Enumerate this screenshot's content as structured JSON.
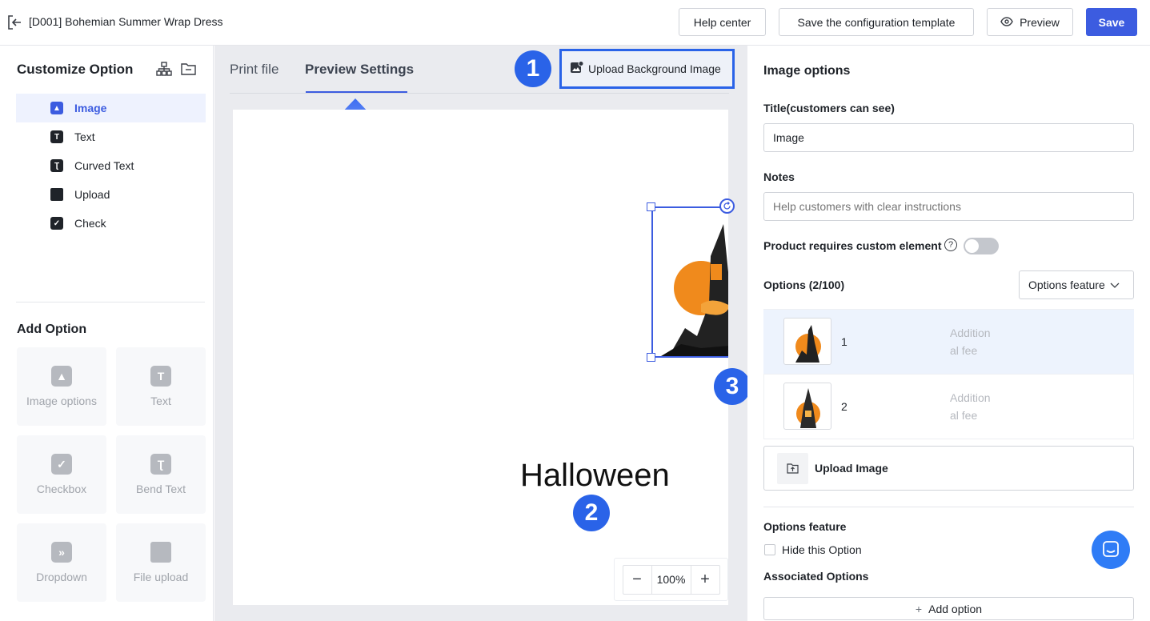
{
  "header": {
    "title": "[D001] Bohemian Summer Wrap Dress",
    "help_label": "Help center",
    "save_template_label": "Save the configuration template",
    "preview_label": "Preview",
    "save_label": "Save",
    "accent": "#3c5ce0"
  },
  "left": {
    "title": "Customize Option",
    "items": [
      {
        "label": "Image",
        "icon": "image-icon",
        "active": true
      },
      {
        "label": "Text",
        "icon": "text-icon"
      },
      {
        "label": "Curved Text",
        "icon": "curved-text-icon"
      },
      {
        "label": "Upload",
        "icon": "folder-icon"
      },
      {
        "label": "Check",
        "icon": "checkbox-icon"
      }
    ],
    "add_title": "Add Option",
    "add_cards": [
      {
        "label": "Image options",
        "icon": "image-icon"
      },
      {
        "label": "Text",
        "icon": "text-icon"
      },
      {
        "label": "Checkbox",
        "icon": "checkbox-icon"
      },
      {
        "label": "Bend Text",
        "icon": "bend-text-icon"
      },
      {
        "label": "Dropdown",
        "icon": "dropdown-icon"
      },
      {
        "label": "File upload",
        "icon": "folder-icon"
      }
    ]
  },
  "middle": {
    "tabs": [
      {
        "label": "Print file"
      },
      {
        "label": "Preview Settings",
        "active": true
      }
    ],
    "upload_bg_label": "Upload Background Image",
    "canvas_text": "Halloween",
    "zoom": "100%",
    "badges": [
      "1",
      "2",
      "3"
    ]
  },
  "right": {
    "title": "Image options",
    "title_label": "Title(customers can see)",
    "title_value": "Image",
    "notes_label": "Notes",
    "notes_placeholder": "Help customers with clear instructions",
    "requires_label": "Product requires custom element",
    "options_label": "Options (2/100)",
    "options_feature_btn": "Options feature",
    "options": [
      {
        "name": "1",
        "fee_placeholder_line1": "Addition",
        "fee_placeholder_line2": "al fee"
      },
      {
        "name": "2",
        "fee_placeholder_line1": "Addition",
        "fee_placeholder_line2": "al fee"
      }
    ],
    "upload_image_label": "Upload Image",
    "feature_title": "Options feature",
    "hide_label": "Hide this Option",
    "associated_label": "Associated Options",
    "add_option_label": "Add option"
  }
}
